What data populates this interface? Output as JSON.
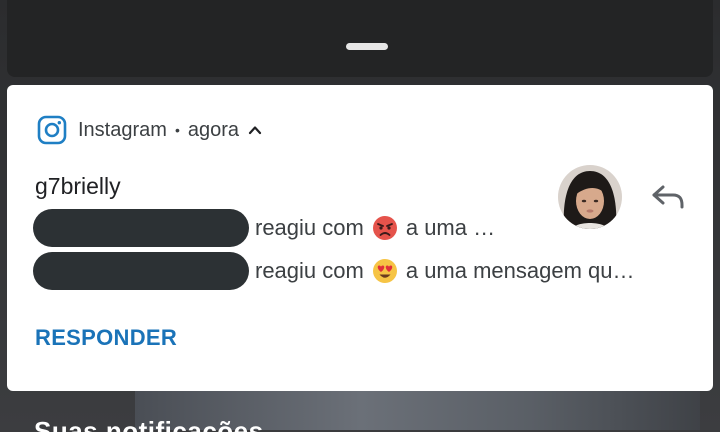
{
  "notification": {
    "app_name": "Instagram",
    "separator": "•",
    "time": "agora",
    "sender": "g7brielly",
    "messages": [
      {
        "text_before": "reagiu com",
        "emoji": "angry-face-emoji",
        "text_after": "a uma …"
      },
      {
        "text_before": "reagiu com",
        "emoji": "heart-eyes-emoji",
        "text_after": "a uma mensagem qu…"
      }
    ],
    "action_label": "RESPONDER",
    "accent_color": "#1a73b8"
  },
  "background": {
    "text": "Suas notificações"
  }
}
